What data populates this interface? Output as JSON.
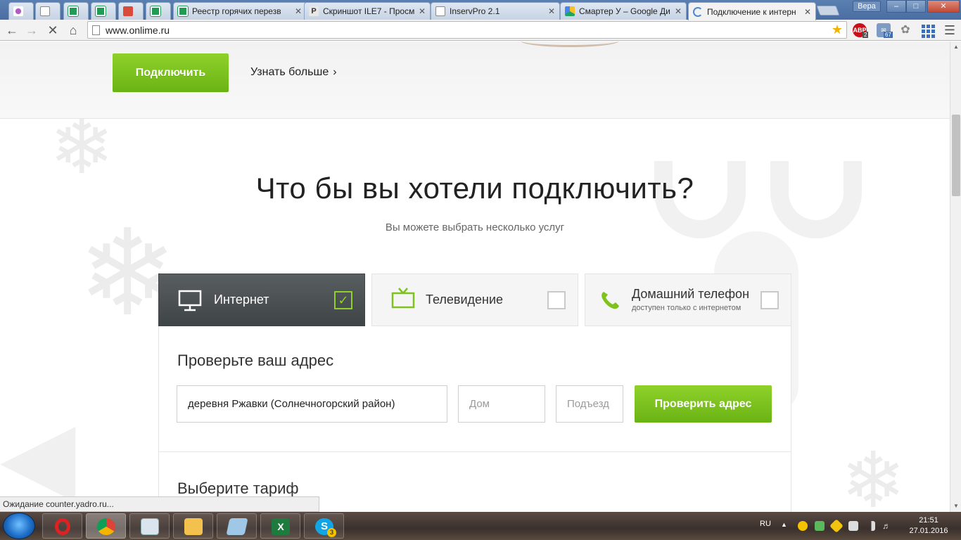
{
  "browser": {
    "tabs": [
      {
        "title": "",
        "icon": "flower-favicon",
        "active": false
      },
      {
        "title": "",
        "icon": "doc-favicon",
        "active": false
      },
      {
        "title": "",
        "icon": "sheet-favicon",
        "active": false
      },
      {
        "title": "",
        "icon": "sheet-favicon",
        "active": false
      },
      {
        "title": "",
        "icon": "red-favicon",
        "active": false
      },
      {
        "title": "",
        "icon": "sheet-favicon",
        "active": false
      },
      {
        "title": "Реестр горячих перезв",
        "icon": "sheet-favicon",
        "active": false
      },
      {
        "title": "Скриншот ILE7 - Просм",
        "icon": "p-favicon",
        "active": false
      },
      {
        "title": "InservPro 2.1",
        "icon": "doc-favicon",
        "active": false
      },
      {
        "title": "Смартер У – Google Ди",
        "icon": "drive-favicon",
        "active": false
      },
      {
        "title": "Подключение к интерн",
        "icon": "loading-spinner",
        "active": true
      }
    ],
    "user": "Вера",
    "window_controls": {
      "minimize": "–",
      "maximize": "□",
      "close": "✕"
    },
    "url": "www.onlime.ru",
    "extensions": {
      "abp": "ABP",
      "abp_count": "2",
      "mail_count": "67"
    },
    "status_text": "Ожидание counter.yadro.ru..."
  },
  "hero": {
    "connect_label": "Подключить",
    "learn_more_label": "Узнать больше"
  },
  "main": {
    "heading": "Что бы вы хотели подключить?",
    "subheading": "Вы можете выбрать несколько услуг",
    "services": [
      {
        "label": "Интернет",
        "sublabel": "",
        "icon": "monitor-icon",
        "checked": true
      },
      {
        "label": "Телевидение",
        "sublabel": "",
        "icon": "tv-icon",
        "checked": false
      },
      {
        "label": "Домашний телефон",
        "sublabel": "доступен только с интернетом",
        "icon": "phone-icon",
        "checked": false
      }
    ],
    "address": {
      "title": "Проверьте ваш адрес",
      "street_value": "деревня Ржавки (Солнечногорский район)",
      "house_placeholder": "Дом",
      "entrance_placeholder": "Подъезд",
      "check_label": "Проверить адрес"
    },
    "tariff_title": "Выберите тариф"
  },
  "taskbar": {
    "apps": [
      "opera",
      "chrome",
      "calculator",
      "explorer",
      "notepad",
      "excel",
      "skype"
    ],
    "skype_badge": "3",
    "lang": "RU",
    "time": "21:51",
    "date": "27.01.2016"
  },
  "colors": {
    "accent_green": "#7ec21e",
    "active_tab_dark": "#4a4f51",
    "text_dark": "#222222"
  }
}
